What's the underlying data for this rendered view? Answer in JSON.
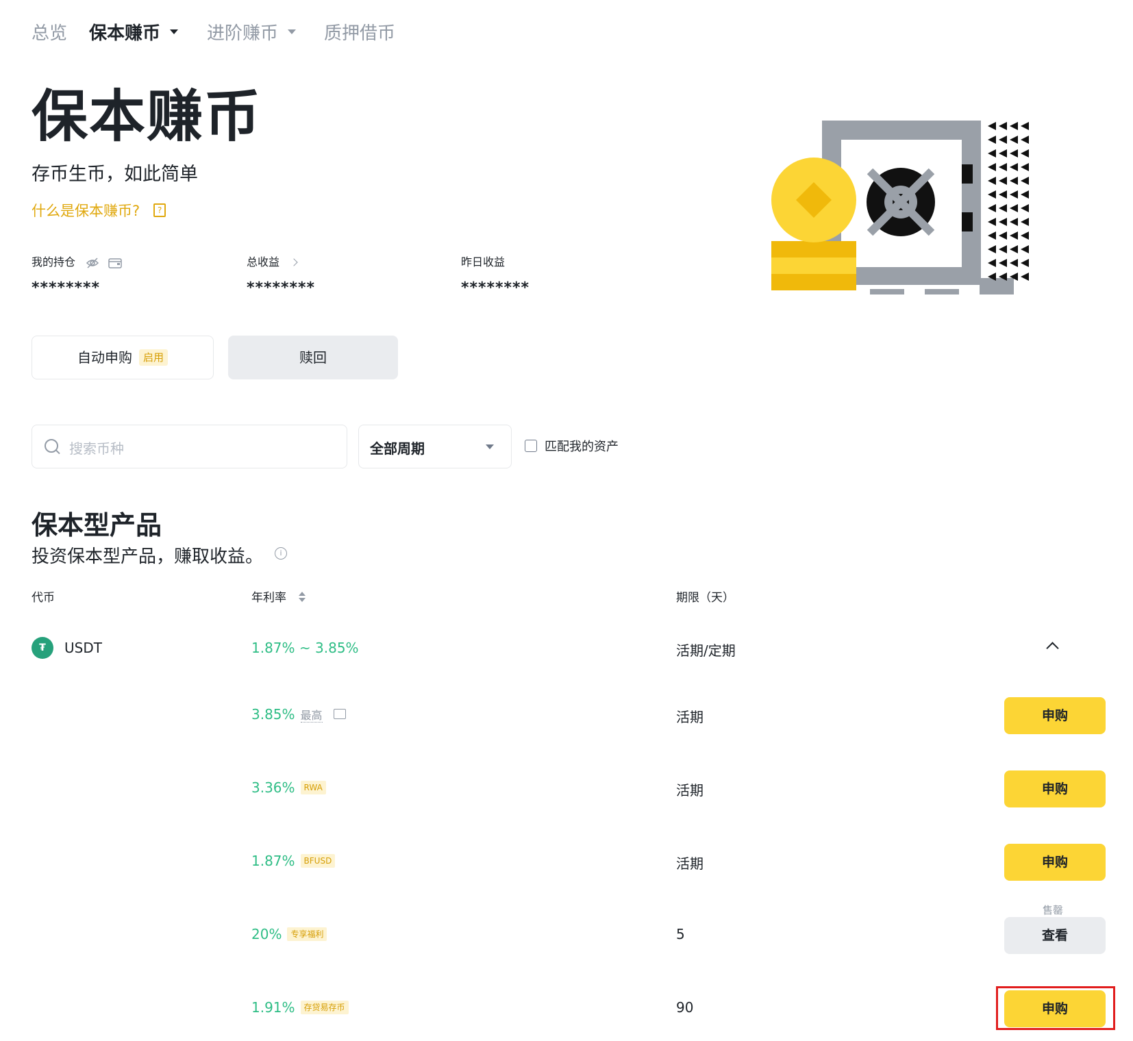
{
  "nav": {
    "overview": "总览",
    "simple_earn": "保本赚币",
    "advanced_earn": "进阶赚币",
    "loans": "质押借币"
  },
  "hero": {
    "title": "保本赚币",
    "subtitle": "存币生币，如此简单",
    "what_link": "什么是保本赚币?"
  },
  "stats": {
    "holdings_label": "我的持仓",
    "holdings_value": "********",
    "total_earnings_label": "总收益",
    "total_earnings_value": "********",
    "yesterday_label": "昨日收益",
    "yesterday_value": "********"
  },
  "actions": {
    "auto_subscribe": "自动申购",
    "auto_subscribe_badge": "启用",
    "redeem": "赎回"
  },
  "filters": {
    "search_placeholder": "搜索币种",
    "period_select": "全部周期",
    "match_assets": "匹配我的资产"
  },
  "section": {
    "title": "保本型产品",
    "subtitle": "投资保本型产品，赚取收益。"
  },
  "table": {
    "headers": {
      "coin": "代币",
      "apr": "年利率",
      "term": "期限（天）"
    },
    "coin": {
      "icon_text": "₮",
      "name": "USDT",
      "apr_range": "1.87% ~ 3.85%",
      "term": "活期/定期"
    },
    "rows": [
      {
        "apr": "3.85%",
        "tag": "最高",
        "term": "活期",
        "button": "申购"
      },
      {
        "apr": "3.36%",
        "tag": "RWA",
        "term": "活期",
        "button": "申购"
      },
      {
        "apr": "1.87%",
        "tag": "BFUSD",
        "term": "活期",
        "button": "申购"
      },
      {
        "apr": "20%",
        "tag": "专享福利",
        "term": "5",
        "button": "查看",
        "status": "售罄"
      },
      {
        "apr": "1.91%",
        "tag": "存贷易存币",
        "term": "90",
        "button": "申购"
      }
    ]
  },
  "colors": {
    "accent_yellow": "#fcd535",
    "apr_green": "#2ebd85",
    "tag_bg": "#fdf3d1",
    "tag_text": "#d69e05",
    "highlight_red": "#e11d1d"
  }
}
